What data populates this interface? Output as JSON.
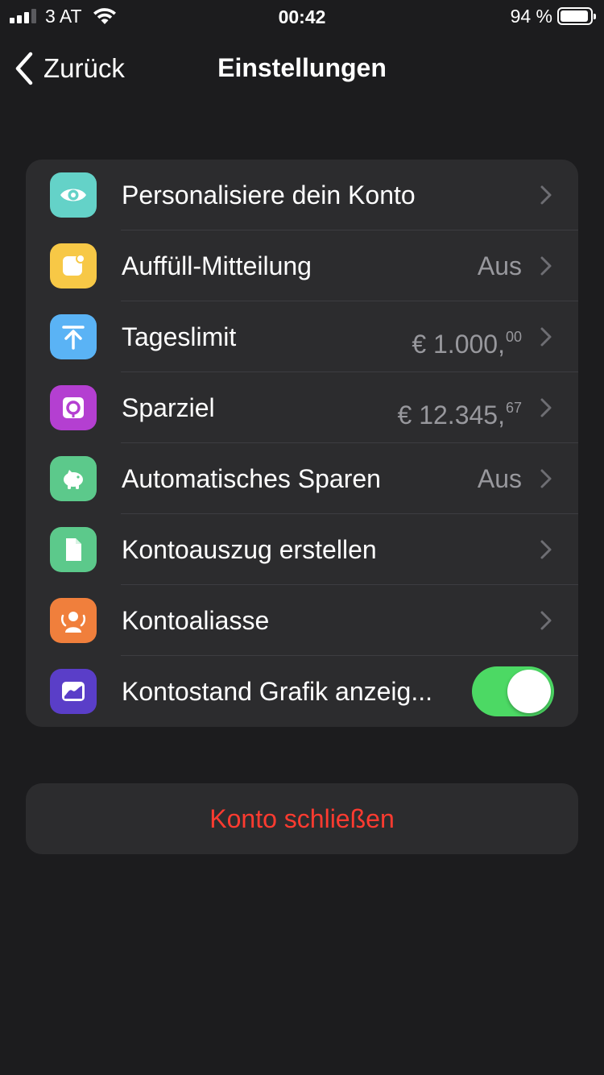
{
  "status_bar": {
    "carrier": "3 AT",
    "time": "00:42",
    "battery_percent": "94 %",
    "signal_bars_active": 3,
    "signal_bars_total": 4,
    "battery_level": 0.94
  },
  "nav": {
    "back_label": "Zurück",
    "title": "Einstellungen"
  },
  "settings": [
    {
      "label": "Personalisiere dein Konto",
      "icon": "eye-icon",
      "icon_color": "#64d2c8",
      "value": "",
      "cents": "",
      "control": "chevron"
    },
    {
      "label": "Auffüll-Mitteilung",
      "icon": "notification-icon",
      "icon_color": "#f7c846",
      "value": "Aus",
      "cents": "",
      "control": "chevron"
    },
    {
      "label": "Tageslimit",
      "icon": "upload-limit-icon",
      "icon_color": "#5ab3f5",
      "value": "€ 1.000,",
      "cents": "00",
      "control": "chevron"
    },
    {
      "label": "Sparziel",
      "icon": "savings-goal-icon",
      "icon_color": "#b43fd1",
      "value": "€ 12.345,",
      "cents": "67",
      "control": "chevron"
    },
    {
      "label": "Automatisches Sparen",
      "icon": "piggy-bank-icon",
      "icon_color": "#5cc98b",
      "value": "Aus",
      "cents": "",
      "control": "chevron"
    },
    {
      "label": "Kontoauszug erstellen",
      "icon": "document-icon",
      "icon_color": "#5cc98b",
      "value": "",
      "cents": "",
      "control": "chevron"
    },
    {
      "label": "Kontoaliasse",
      "icon": "aliases-icon",
      "icon_color": "#f07f3c",
      "value": "",
      "cents": "",
      "control": "chevron"
    },
    {
      "label": "Kontostand Grafik anzeig...",
      "icon": "balance-chart-icon",
      "icon_color": "#5a3ec8",
      "value": "",
      "cents": "",
      "control": "toggle",
      "toggle_on": true
    }
  ],
  "close_account": {
    "label": "Konto schließen",
    "color": "#ff3b30"
  },
  "colors": {
    "background": "#1c1c1e",
    "card": "#2c2c2e",
    "toggle_on": "#4cd964",
    "secondary_text": "#98989d"
  }
}
